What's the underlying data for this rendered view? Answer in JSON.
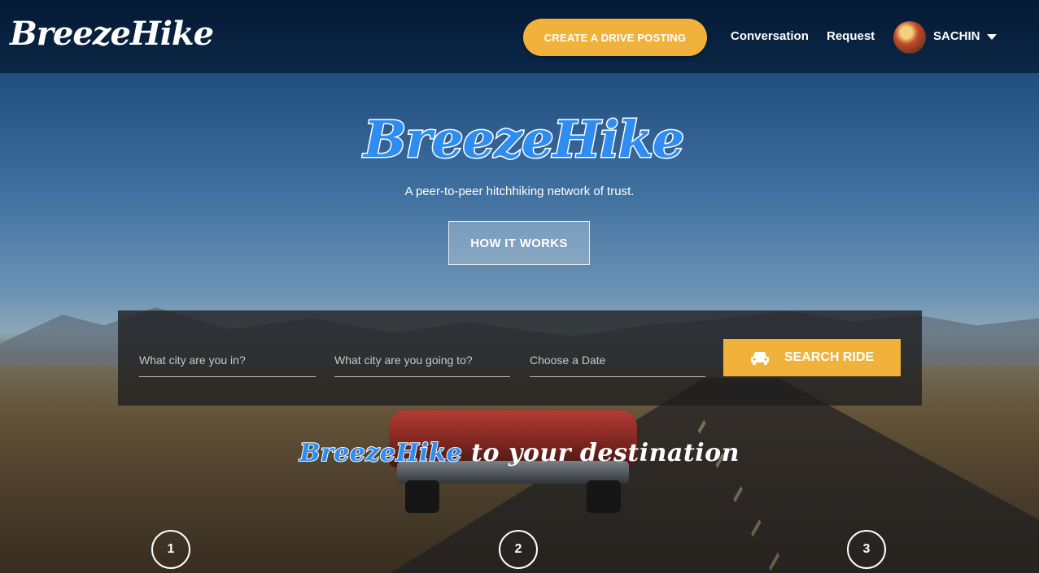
{
  "header": {
    "logo": "BreezeHike",
    "cta_label": "CREATE A DRIVE POSTING",
    "nav": [
      "Conversation",
      "Request"
    ],
    "user_name": "SACHIN"
  },
  "hero": {
    "logo": "BreezeHike",
    "tagline": "A peer-to-peer hitchhiking network of trust.",
    "how_button": "HOW IT WORKS"
  },
  "search": {
    "from_placeholder": "What city are you in?",
    "to_placeholder": "What city are you going to?",
    "date_placeholder": "Choose a Date",
    "button_label": "SEARCH RIDE"
  },
  "destination": {
    "brand": "BreezeHike",
    "rest": " to your destination"
  },
  "steps": [
    "1",
    "2",
    "3"
  ],
  "colors": {
    "accent": "#f0b23a",
    "brand_blue": "#2f8cf0",
    "header_bg": "#041a36"
  }
}
